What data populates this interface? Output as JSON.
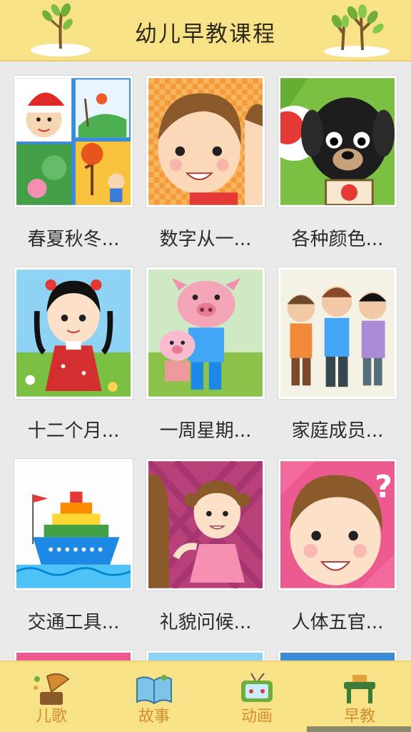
{
  "header": {
    "title": "幼儿早教课程"
  },
  "courses": [
    {
      "label": "春夏秋冬..."
    },
    {
      "label": "数字从一..."
    },
    {
      "label": "各种颜色..."
    },
    {
      "label": "十二个月..."
    },
    {
      "label": "一周星期..."
    },
    {
      "label": "家庭成员..."
    },
    {
      "label": "交通工具..."
    },
    {
      "label": "礼貌问候..."
    },
    {
      "label": "人体五官..."
    }
  ],
  "tabs": [
    {
      "label": "儿歌",
      "icon": "gramophone-icon"
    },
    {
      "label": "故事",
      "icon": "book-icon"
    },
    {
      "label": "动画",
      "icon": "tv-icon"
    },
    {
      "label": "早教",
      "icon": "desk-icon"
    }
  ],
  "colors": {
    "header_bg": "#f8e288",
    "tab_label": "#d58c2e",
    "background": "#eaeaea"
  }
}
